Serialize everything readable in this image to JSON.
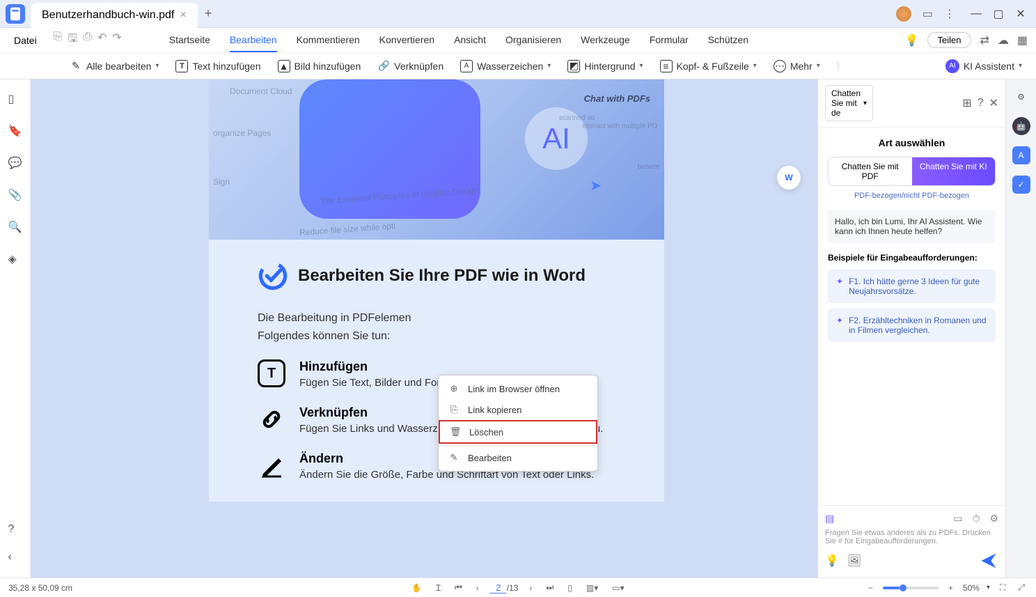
{
  "titlebar": {
    "tab_title": "Benutzerhandbuch-win.pdf"
  },
  "menubar": {
    "file": "Datei",
    "tabs": [
      "Startseite",
      "Bearbeiten",
      "Kommentieren",
      "Konvertieren",
      "Ansicht",
      "Organisieren",
      "Werkzeuge",
      "Formular",
      "Schützen"
    ],
    "active_tab": 1,
    "share": "Teilen"
  },
  "toolbar": {
    "edit_all": "Alle bearbeiten",
    "add_text": "Text hinzufügen",
    "add_image": "Bild hinzufügen",
    "link": "Verknüpfen",
    "watermark": "Wasserzeichen",
    "background": "Hintergrund",
    "header_footer": "Kopf- & Fußzeile",
    "more": "Mehr",
    "ki_assistant": "KI Assistent",
    "ki_badge": "AI"
  },
  "document": {
    "hero": {
      "chat_label": "Chat with PDFs",
      "ai": "AI",
      "ghost1": "Document Cloud",
      "ghost2": "organize Pages",
      "ghost3": "Sign",
      "ghost4": "The Essential Principles of Graphic Design",
      "ghost5": "Reduce file size while opti",
      "ghost6": "scanned so",
      "ghost7": "Interact with multiple PD",
      "ghost8": "betwee"
    },
    "headline": "Bearbeiten Sie Ihre PDF wie in Word",
    "intro1": "Die Bearbeitung in PDFelemen",
    "intro2": "Folgendes können Sie tun:",
    "features": [
      {
        "title": "Hinzufügen",
        "desc": "Fügen Sie Text, Bilder und Formen zu PDFs hinzu."
      },
      {
        "title": "Verknüpfen",
        "desc": "Fügen Sie Links und Wasserzeichen zu Ihren PDF-Dateien hinzu."
      },
      {
        "title": "Ändern",
        "desc": "Ändern Sie die Größe, Farbe und Schriftart von Text oder Links."
      }
    ]
  },
  "context_menu": {
    "items": [
      "Link im Browser öffnen",
      "Link kopieren",
      "Löschen",
      "Bearbeiten"
    ],
    "highlighted": 2
  },
  "right_panel": {
    "dropdown": "Chatten Sie mit de",
    "title": "Art auswählen",
    "toggle": [
      "Chatten Sie mit PDF",
      "Chatten Sie mit KI"
    ],
    "toggle_active": 1,
    "subtitle": "PDF-bezogen/nicht PDF-bezogen",
    "greeting": "Hallo, ich bin Lumi, Ihr AI Assistent. Wie kann ich Ihnen heute helfen?",
    "examples_title": "Beispiele für Eingabeaufforderungen:",
    "examples": [
      "F1. Ich hätte gerne 3 Ideen für gute Neujahrsvorsätze.",
      "F2. Erzähltechniken in Romanen und in Filmen vergleichen."
    ],
    "input_hint": "Fragen Sie etwas anderes als zu PDFs. Drücken Sie # für Eingabeaufforderungen."
  },
  "statusbar": {
    "dimensions": "35,28 x 50,09 cm",
    "page_current": "2",
    "page_total": "/13",
    "zoom": "50%"
  },
  "float_badge": "W"
}
